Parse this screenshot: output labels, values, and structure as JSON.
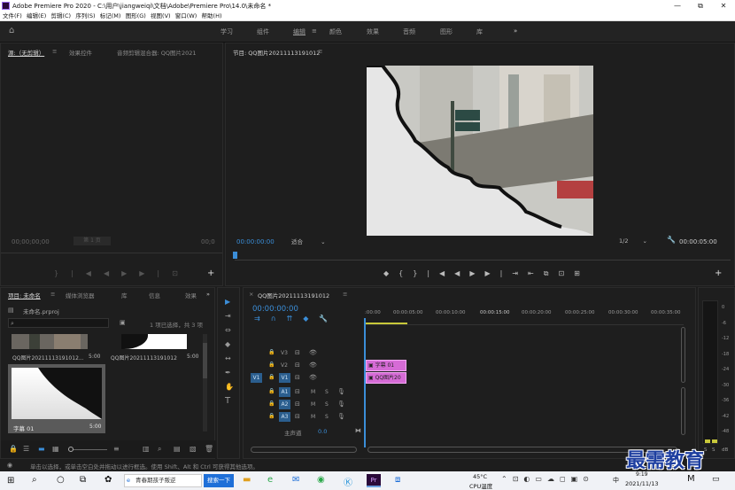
{
  "window": {
    "title": "Adobe Premiere Pro 2020 - C:\\用户\\jiangweiqi\\文档\\Adobe\\Premiere Pro\\14.0\\未命名 *",
    "controls": [
      "—",
      "⧉",
      "✕"
    ]
  },
  "menu": [
    "文件(F)",
    "编辑(E)",
    "剪辑(C)",
    "序列(S)",
    "标记(M)",
    "图形(G)",
    "视图(V)",
    "窗口(W)",
    "帮助(H)"
  ],
  "workspaces": [
    "学习",
    "组件",
    "编辑",
    "颜色",
    "效果",
    "音频",
    "图形",
    "库"
  ],
  "workspace_active": "编辑",
  "workspace_menu": "≡",
  "workspace_more": "»",
  "source_panel": {
    "tabs": [
      "源:（无剪辑）",
      "效果控件",
      "音频剪辑混合器: QQ图片2021"
    ],
    "menu": "≡",
    "timecode": "00;00;00;00",
    "timecode_right": "00;0",
    "page": "第 1 页"
  },
  "program_panel": {
    "tab": "节目: QQ图片20211113191012",
    "menu": "≡",
    "timecode": "00:00:00:00",
    "fit": "适合",
    "fraction": "1/2",
    "duration": "00:00:05:00"
  },
  "project_panel": {
    "tabs": [
      "项目: 未命名",
      "媒体浏览器",
      "库",
      "信息",
      "效果"
    ],
    "menu": "≡",
    "more": "»",
    "project_file": "未命名.prproj",
    "selection": "1 项已选择，共 3 项",
    "items": [
      {
        "name": "QQ图片20211113191012...",
        "dur": "5:00"
      },
      {
        "name": "QQ图片20211113191012",
        "dur": "5:00"
      },
      {
        "name": "字幕 01",
        "dur": "5:00"
      }
    ]
  },
  "timeline": {
    "tab": "QQ图片20211113191012",
    "menu": "≡",
    "timecode": "00:00:00:00",
    "ruler": [
      ":00:00",
      "00:00:05:00",
      "00:00:10:00",
      "00:00:15:00",
      "00:00:20:00",
      "00:00:25:00",
      "00:00:30:00",
      "00:00:35:00"
    ],
    "tracks": [
      {
        "name": "V3"
      },
      {
        "name": "V2"
      },
      {
        "name": "V1",
        "src": "V1"
      },
      {
        "name": "A1"
      },
      {
        "name": "A2"
      },
      {
        "name": "A3"
      }
    ],
    "master": "主声道",
    "master_val": "0.0",
    "clips": [
      {
        "label": "字幕 01"
      },
      {
        "label": "QQ图片20"
      }
    ]
  },
  "tools": [
    "▶",
    "⇥",
    "⇔",
    "◆",
    "↔",
    "✒",
    "✋",
    "T"
  ],
  "audio_meter": {
    "labels": [
      "0",
      "-6",
      "-12",
      "-18",
      "-24",
      "-30",
      "-36",
      "-42",
      "-48"
    ],
    "unit": "dB",
    "solo": [
      "S",
      "S"
    ]
  },
  "status": "单击以选择，或单击空白处并拖动以进行框选。使用 Shift、Alt 和 Ctrl 可获得其他选项。",
  "taskbar": {
    "search_text": "青春期孩子叛逆",
    "search_btn": "搜索一下",
    "weather_temp": "45°C",
    "weather_label": "CPU温度",
    "lang": "中",
    "time": "9:19",
    "date": "2021/11/13"
  },
  "watermark": "最需教育",
  "colors": {
    "accent": "#3b8ed8",
    "clip": "#d66bd6",
    "bg": "#1d1d1d"
  }
}
